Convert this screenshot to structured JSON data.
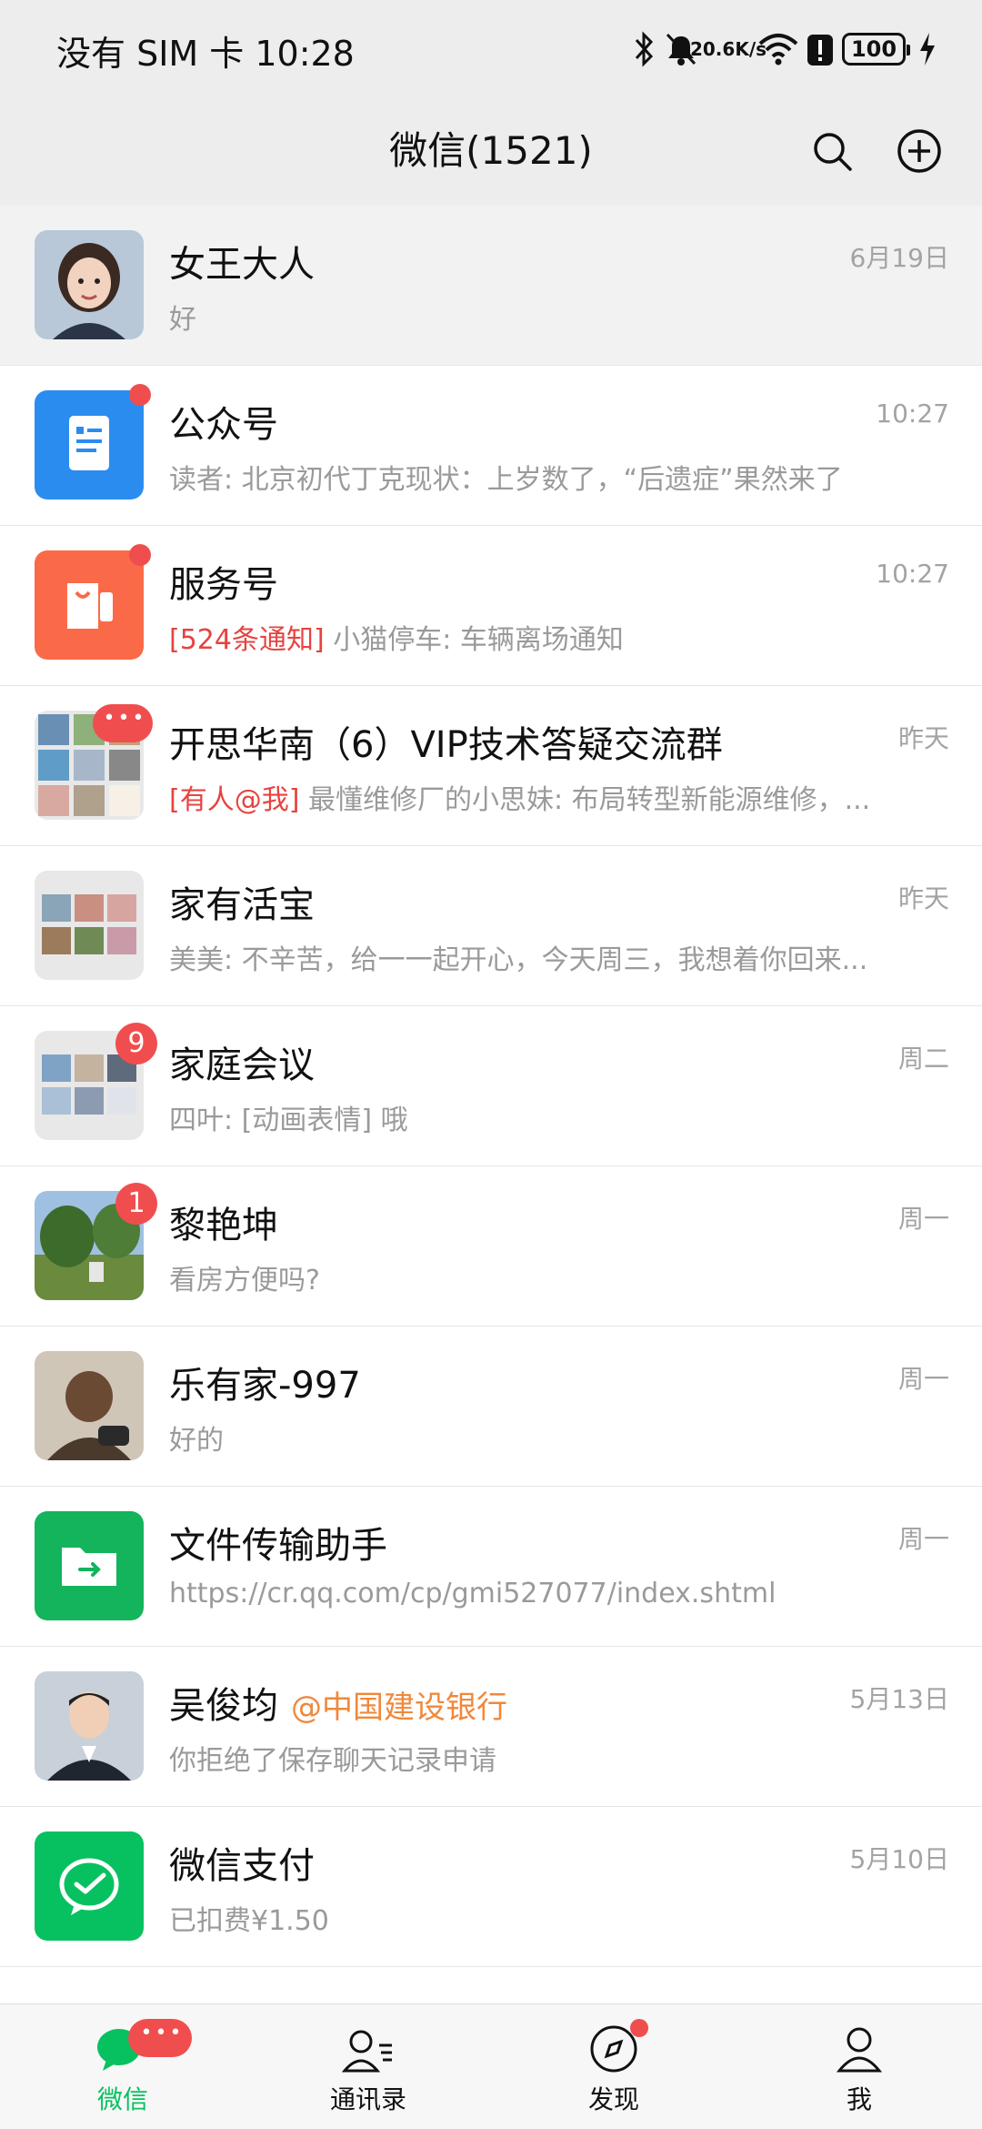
{
  "status_bar": {
    "left_text": "没有 SIM 卡 10:28",
    "net_speed_value": "20.6",
    "net_speed_unit": "K/s",
    "battery": "100",
    "icons": [
      "bluetooth-icon",
      "mute-icon",
      "wifi-icon",
      "alert-icon",
      "charging-icon"
    ]
  },
  "header": {
    "title": "微信(1521)",
    "icons": [
      "search-icon",
      "add-icon"
    ]
  },
  "chats": [
    {
      "name": "女王大人",
      "preview": "好",
      "time": "6月19日",
      "pinned": true
    },
    {
      "name": "公众号",
      "preview": "读者: 北京初代丁克现状：上岁数了，“后遗症”果然来了",
      "time": "10:27",
      "dot": true
    },
    {
      "name": "服务号",
      "preview_red": "[524条通知]",
      "preview": " 小猫停车: 车辆离场通知",
      "time": "10:27",
      "dot": true
    },
    {
      "name": "开思华南（6）VIP技术答疑交流群",
      "preview_red": "[有人@我]",
      "preview": " 最懂维修厂的小思妹: 布局转型新能源维修，...",
      "time": "昨天"
    },
    {
      "name": "家有活宝",
      "preview": "美美: 不辛苦，给一一起开心，今天周三，我想着你回来...",
      "time": "昨天"
    },
    {
      "name": "家庭会议",
      "preview": "四叶: [动画表情] 哦",
      "time": "周二",
      "badge": "9"
    },
    {
      "name": "黎艳坤",
      "preview": "看房方便吗?",
      "time": "周一",
      "badge": "1"
    },
    {
      "name": "乐有家-997",
      "preview": "好的",
      "time": "周一"
    },
    {
      "name": "文件传输助手",
      "preview": "https://cr.qq.com/cp/gmi527077/index.shtml",
      "time": "周一"
    },
    {
      "name": "吴俊均",
      "mention": "@中国建设银行",
      "preview": "你拒绝了保存聊天记录申请",
      "time": "5月13日"
    },
    {
      "name": "微信支付",
      "preview": "已扣费¥1.50",
      "time": "5月10日"
    }
  ],
  "bottom_nav": [
    {
      "label": "微信",
      "icon": "chat-icon",
      "active": true
    },
    {
      "label": "通讯录",
      "icon": "contacts-icon"
    },
    {
      "label": "发现",
      "icon": "compass-icon",
      "dot": true
    },
    {
      "label": "我",
      "icon": "profile-icon"
    }
  ],
  "colors": {
    "accent_green": "#07c160",
    "badge_red": "#f04e4e",
    "mention_orange": "#f0883a"
  }
}
